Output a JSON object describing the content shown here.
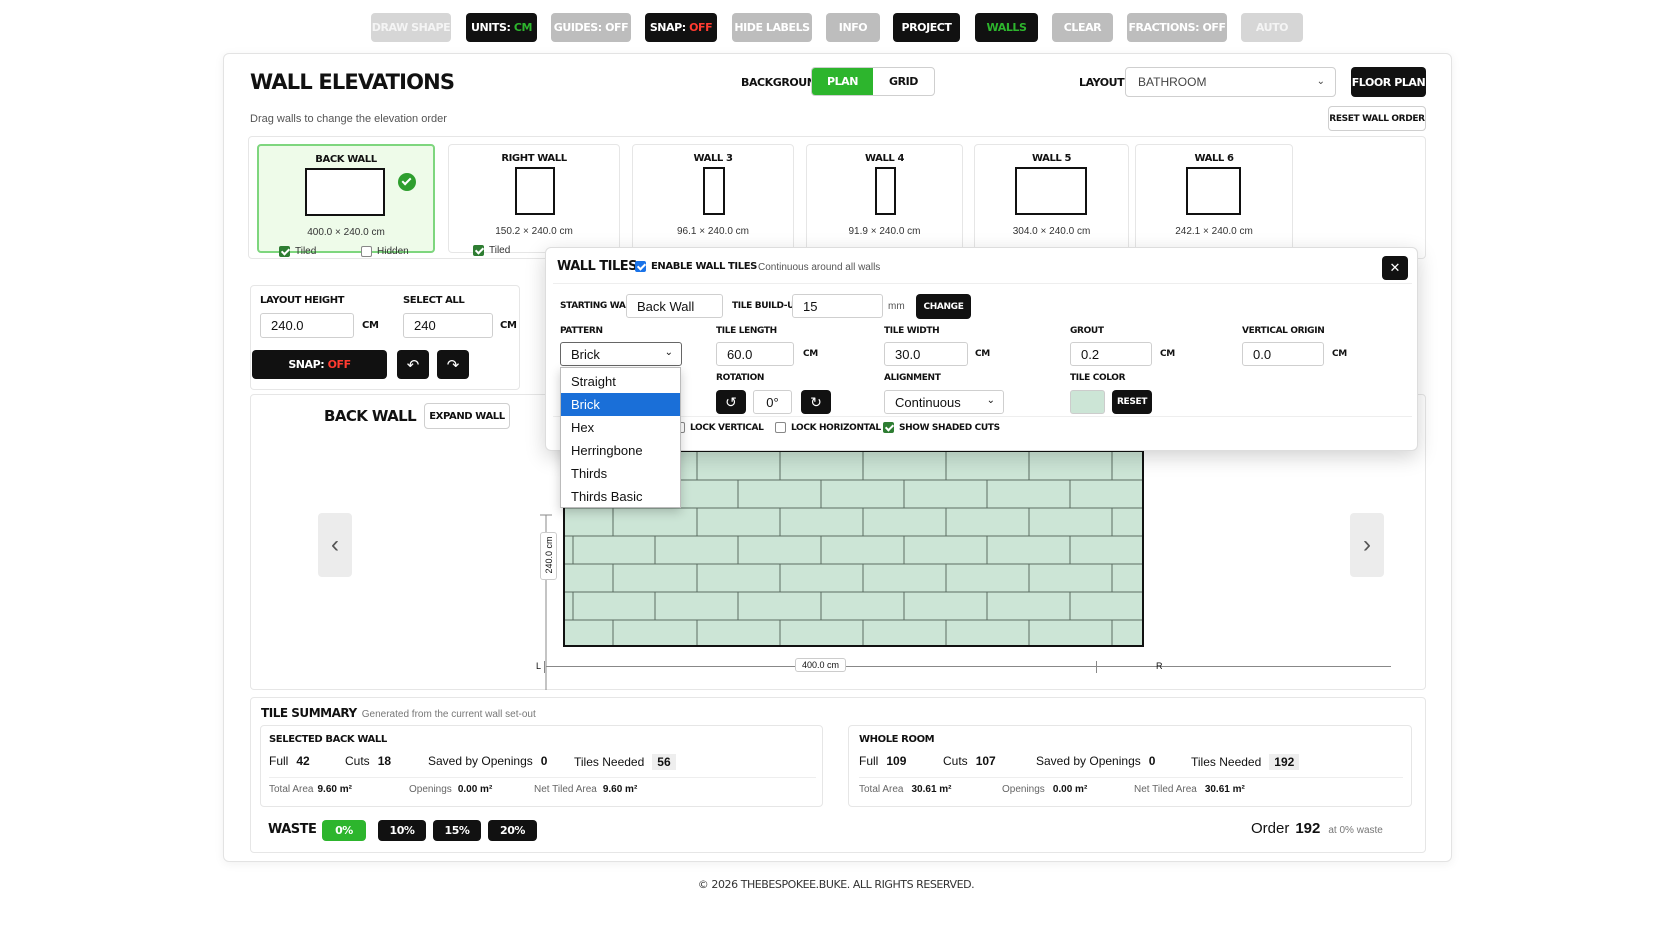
{
  "toolbar": {
    "items": [
      {
        "label": "DRAW SHAPE"
      },
      {
        "label": "UNITS:",
        "value": "CM"
      },
      {
        "label": "GUIDES: OFF"
      },
      {
        "label": "SNAP:",
        "value": "OFF"
      },
      {
        "label": "HIDE LABELS"
      },
      {
        "label": "INFO"
      },
      {
        "label": "PROJECT"
      },
      {
        "label": "WALLS"
      },
      {
        "label": "CLEAR"
      },
      {
        "label": "FRACTIONS: OFF"
      },
      {
        "label": "AUTO"
      }
    ]
  },
  "header": {
    "title": "WALL ELEVATIONS",
    "hint": "Drag walls to change the elevation order",
    "background_label": "BACKGROUND",
    "background_options": [
      "PLAN",
      "GRID"
    ],
    "layout_label": "LAYOUT",
    "layout_value": "BATHROOM",
    "floor_plan_button": "FLOOR PLAN",
    "reset_order_button": "RESET WALL ORDER"
  },
  "walls": [
    {
      "name": "BACK WALL",
      "size": "400.0 × 240.0 cm",
      "tiled_label": "Tiled",
      "hidden_label": "Hidden"
    },
    {
      "name": "RIGHT WALL",
      "size": "150.2 × 240.0 cm",
      "tiled_label": "Tiled"
    },
    {
      "name": "WALL 3",
      "size": "96.1 × 240.0 cm"
    },
    {
      "name": "WALL 4",
      "size": "91.9 × 240.0 cm"
    },
    {
      "name": "WALL 5",
      "size": "304.0 × 240.0 cm"
    },
    {
      "name": "WALL 6",
      "size": "242.1 × 240.0 cm"
    }
  ],
  "controls": {
    "layout_height_label": "LAYOUT HEIGHT",
    "layout_height_value": "240.0",
    "select_all_label": "SELECT ALL",
    "select_all_value": "240",
    "unit": "CM",
    "snap_label": "SNAP:",
    "snap_value": "OFF"
  },
  "elevation": {
    "title": "BACK WALL",
    "expand_button": "EXPAND WALL",
    "height_dim": "240.0 cm",
    "width_dim": "400.0 cm",
    "left_marker": "L",
    "right_marker": "R",
    "prev": "‹",
    "next": "›"
  },
  "wall_tiles_panel": {
    "title": "WALL TILES",
    "enable_label": "ENABLE WALL TILES",
    "continuous_note": "Continuous around all walls",
    "starting_wall_label": "STARTING WALL",
    "starting_wall_value": "Back Wall",
    "build_up_label": "TILE BUILD-UP",
    "build_up_value": "15",
    "build_up_unit": "mm",
    "change_button": "CHANGE",
    "pattern_label": "PATTERN",
    "pattern_value": "Brick",
    "pattern_options": [
      "Straight",
      "Brick",
      "Hex",
      "Herringbone",
      "Thirds",
      "Thirds Basic"
    ],
    "tile_length_label": "TILE LENGTH",
    "tile_length_value": "60.0",
    "tile_width_label": "TILE WIDTH",
    "tile_width_value": "30.0",
    "grout_label": "GROUT",
    "grout_value": "0.2",
    "vertical_origin_label": "VERTICAL ORIGIN",
    "vertical_origin_value": "0.0",
    "unit": "CM",
    "rotation_label": "ROTATION",
    "rotation_value": "0°",
    "alignment_label": "ALIGNMENT",
    "alignment_value": "Continuous",
    "tile_color_label": "TILE COLOR",
    "tile_color": "#cce5d6",
    "reset_button": "RESET",
    "lock_vertical": "LOCK VERTICAL",
    "lock_horizontal": "LOCK HORIZONTAL",
    "show_shaded_cuts": "SHOW SHADED CUTS",
    "close": "✕"
  },
  "summary": {
    "title": "TILE SUMMARY",
    "subtitle": "Generated from the current wall set-out",
    "selected": {
      "title": "SELECTED BACK WALL",
      "full_label": "Full",
      "full": "42",
      "cuts_label": "Cuts",
      "cuts": "18",
      "saved_label": "Saved by Openings",
      "saved": "0",
      "needed_label": "Tiles Needed",
      "needed": "56",
      "area_label": "Total Area",
      "area": "9.60 m²",
      "openings_label": "Openings",
      "openings": "0.00 m²",
      "net_label": "Net Tiled Area",
      "net": "9.60 m²"
    },
    "room": {
      "title": "WHOLE ROOM",
      "full_label": "Full",
      "full": "109",
      "cuts_label": "Cuts",
      "cuts": "107",
      "saved_label": "Saved by Openings",
      "saved": "0",
      "needed_label": "Tiles Needed",
      "needed": "192",
      "area_label": "Total Area",
      "area": "30.61 m²",
      "openings_label": "Openings",
      "openings": "0.00 m²",
      "net_label": "Net Tiled Area",
      "net": "30.61 m²"
    },
    "waste_label": "WASTE",
    "waste_options": [
      "0%",
      "10%",
      "15%",
      "20%"
    ],
    "order_label": "Order",
    "order_value": "192",
    "order_note": "at 0% waste"
  },
  "footer": "© 2026 THEBESPOKEE.BUKE. ALL RIGHTS RESERVED.",
  "colors": {
    "accent": "#2db52d",
    "snap_off": "#ff3b30",
    "tile": "#cce5d6",
    "selected_card": "#eefbe9"
  }
}
